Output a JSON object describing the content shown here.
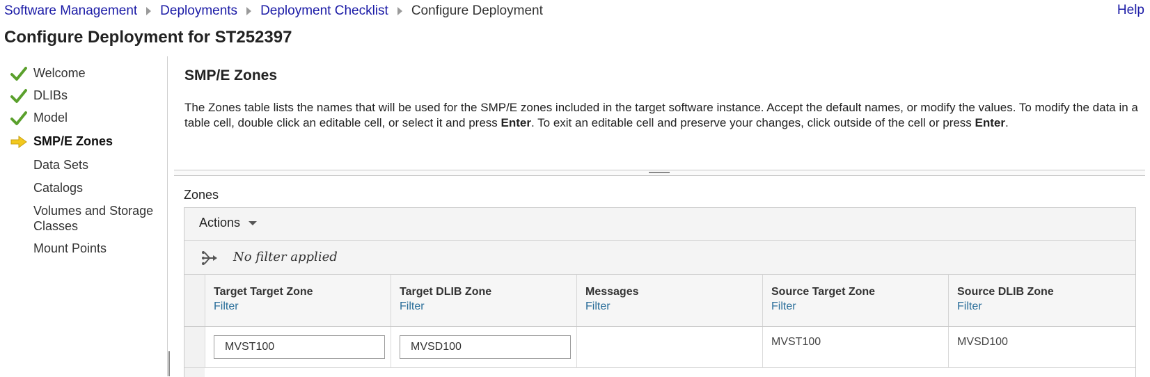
{
  "breadcrumb": {
    "items": [
      "Software Management",
      "Deployments",
      "Deployment Checklist"
    ],
    "current": "Configure Deployment"
  },
  "help_label": "Help",
  "page_title": "Configure Deployment for ST252397",
  "nav": {
    "items": [
      {
        "label": "Welcome",
        "status": "complete",
        "icon": "checkmark-icon"
      },
      {
        "label": "DLIBs",
        "status": "complete",
        "icon": "checkmark-icon"
      },
      {
        "label": "Model",
        "status": "complete",
        "icon": "checkmark-icon"
      },
      {
        "label": "SMP/E Zones",
        "status": "current",
        "icon": "arrow-right-icon"
      },
      {
        "label": "Data Sets",
        "status": "pending"
      },
      {
        "label": "Catalogs",
        "status": "pending"
      },
      {
        "label": "Volumes and Storage Classes",
        "status": "pending"
      },
      {
        "label": "Mount Points",
        "status": "pending"
      }
    ]
  },
  "section": {
    "title": "SMP/E Zones",
    "desc_1": "The Zones table lists the names that will be used for the SMP/E zones included in the target software instance.  Accept the default names, or modify the values. To modify the data in a table cell, double click an editable cell, or select it and press ",
    "desc_enter_1": "Enter",
    "desc_2": ".  To exit an editable cell and preserve your changes, click outside of the cell or press ",
    "desc_enter_2": "Enter",
    "desc_3": "."
  },
  "zones": {
    "label": "Zones",
    "actions_label": "Actions",
    "filter_status": "No filter applied",
    "columns": [
      {
        "title": "Target Target Zone",
        "filter": "Filter"
      },
      {
        "title": "Target DLIB Zone",
        "filter": "Filter"
      },
      {
        "title": "Messages",
        "filter": "Filter"
      },
      {
        "title": "Source Target Zone",
        "filter": "Filter"
      },
      {
        "title": "Source DLIB Zone",
        "filter": "Filter"
      }
    ],
    "rows": [
      {
        "target_target_zone": "MVST100",
        "target_dlib_zone": "MVSD100",
        "messages": "",
        "source_target_zone": "MVST100",
        "source_dlib_zone": "MVSD100"
      }
    ]
  },
  "colors": {
    "link": "#1a1aa6",
    "check_green": "#5aa02c",
    "arrow_yellow": "#f2c81e",
    "filter_link": "#2a6e9a"
  }
}
